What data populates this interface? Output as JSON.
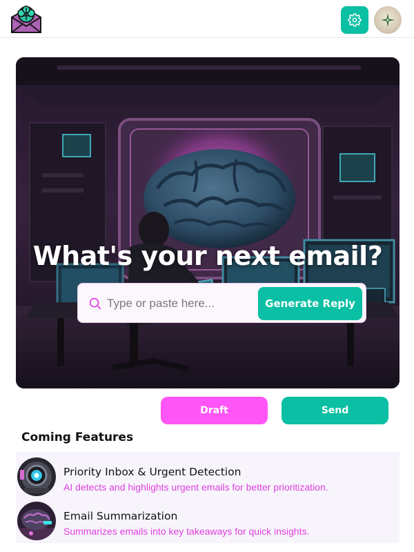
{
  "app": {
    "logo_icon": "brain-envelope-icon",
    "settings_icon": "gear-icon",
    "avatar_icon": "compass-star-avatar"
  },
  "hero": {
    "title": "What's your next email?",
    "search_placeholder": "Type or paste here...",
    "search_value": "",
    "generate_label": "Generate Reply"
  },
  "actions": {
    "draft_label": "Draft",
    "send_label": "Send"
  },
  "features": {
    "heading": "Coming Features",
    "items": [
      {
        "title": "Priority Inbox & Urgent Detection",
        "description": "AI detects and highlights urgent emails for better prioritization.",
        "icon": "robot-eye-thumbnail"
      },
      {
        "title": "Email Summarization",
        "description": "Summarizes emails into key takeaways for quick insights.",
        "icon": "cyber-brain-thumbnail"
      }
    ]
  },
  "colors": {
    "accent_teal": "#0abfa3",
    "accent_pink": "#ff55f6",
    "description_pink": "#e03ee0"
  }
}
